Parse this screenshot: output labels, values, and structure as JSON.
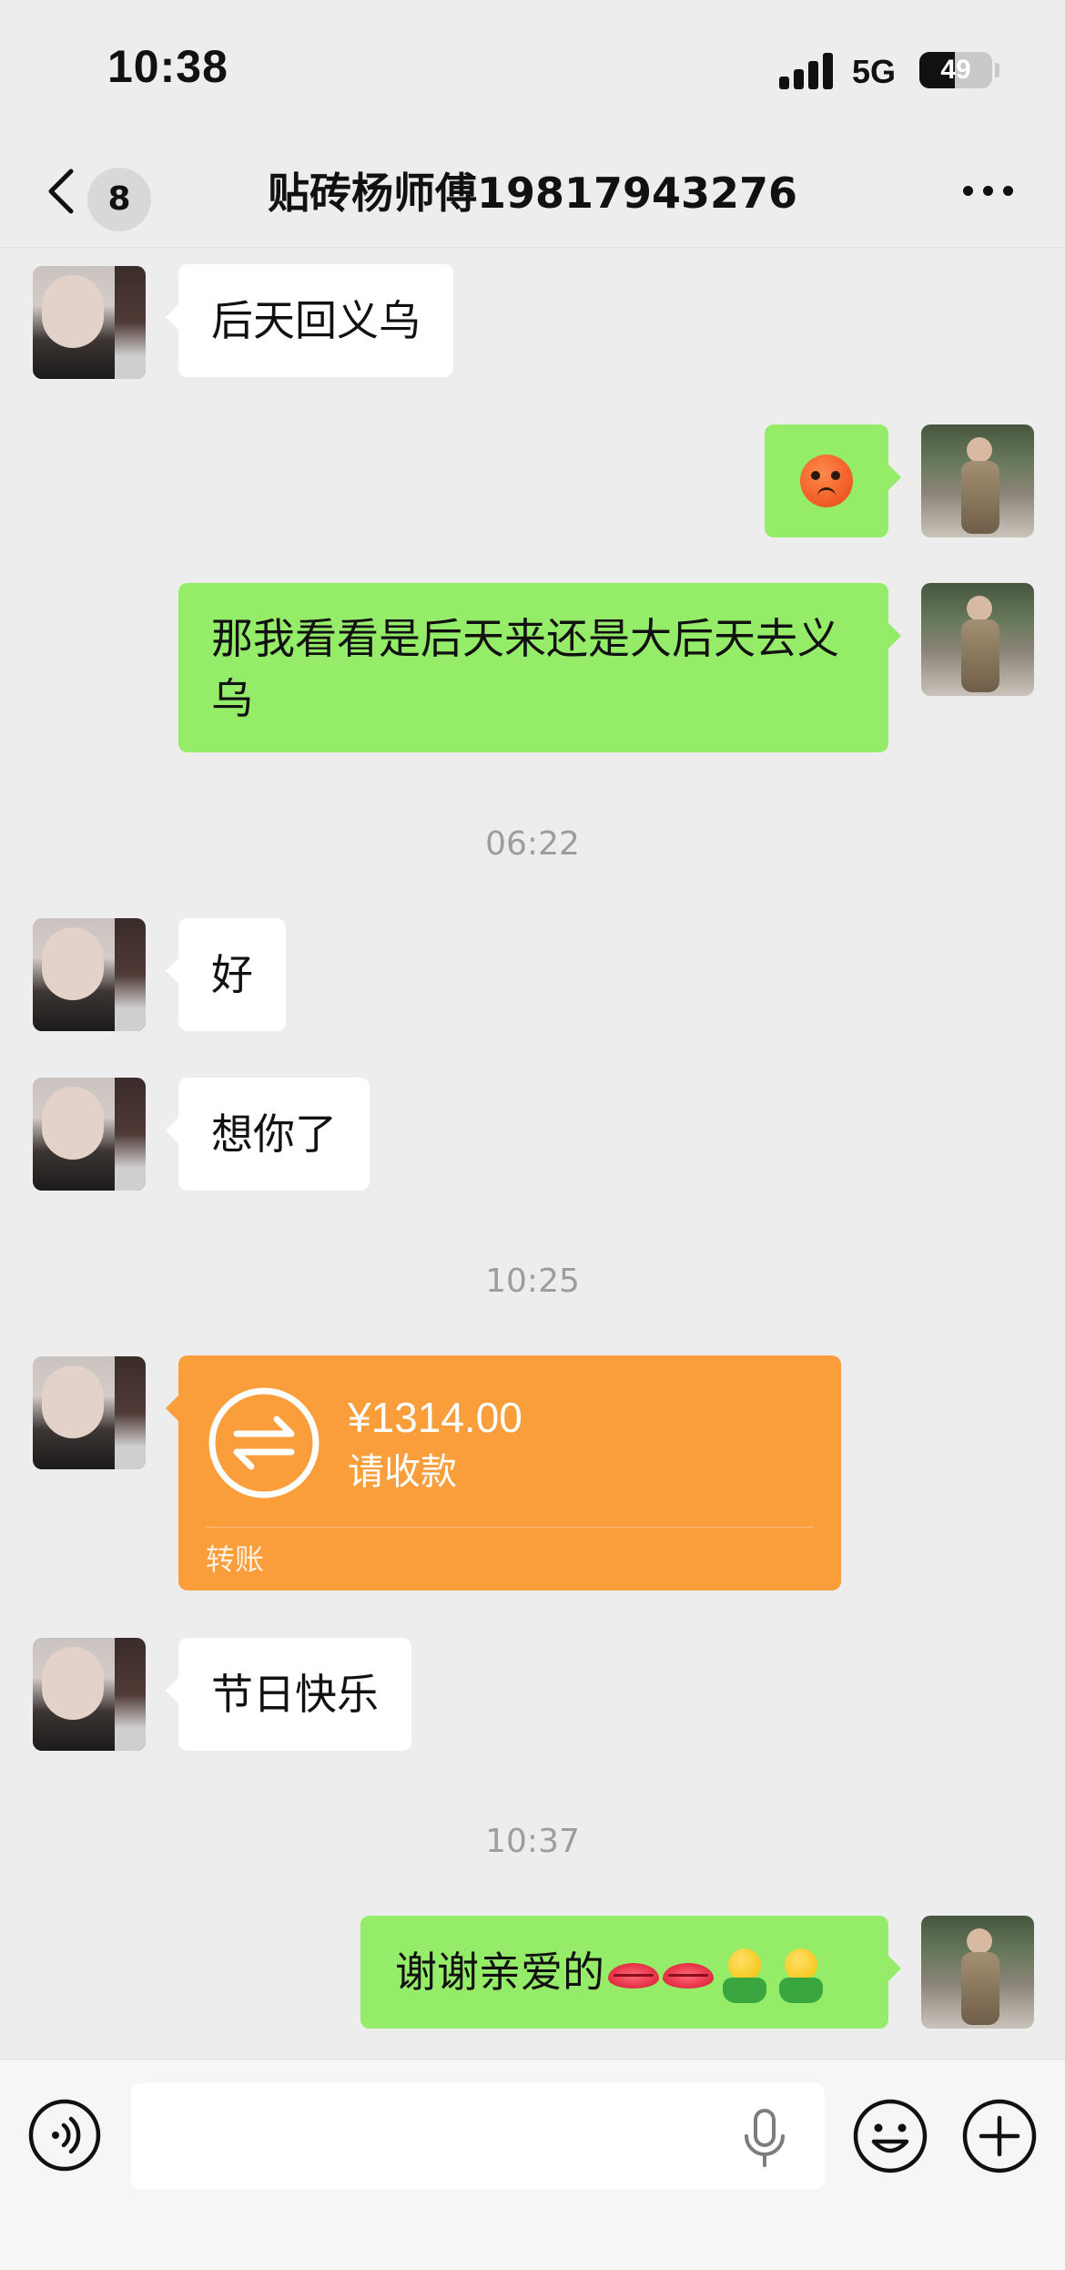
{
  "status_bar": {
    "time": "10:38",
    "network": "5G",
    "battery": "49",
    "battery_level_percent": 49,
    "signal_bars": 4
  },
  "nav": {
    "unread_count": "8",
    "title": "贴砖杨师傅19817943276",
    "icons": [
      "chevron-left-icon",
      "more-icon"
    ]
  },
  "messages": [
    {
      "from": "friend",
      "type": "text",
      "text": "后天回义乌"
    },
    {
      "from": "me",
      "type": "emoji",
      "emoji": "hot-face-emoji"
    },
    {
      "from": "me",
      "type": "text",
      "text": "那我看看是后天来还是大后天去义乌"
    },
    {
      "type": "timestamp",
      "text": "06:22"
    },
    {
      "from": "friend",
      "type": "text",
      "text": "好"
    },
    {
      "from": "friend",
      "type": "text",
      "text": "想你了"
    },
    {
      "type": "timestamp",
      "text": "10:25"
    },
    {
      "from": "friend",
      "type": "transfer",
      "amount": "¥1314.00",
      "status": "请收款",
      "label": "转账"
    },
    {
      "from": "friend",
      "type": "text",
      "text": "节日快乐"
    },
    {
      "type": "timestamp",
      "text": "10:37"
    },
    {
      "from": "me",
      "type": "text",
      "text": "谢谢亲爱的",
      "emojis": [
        "lips-emoji",
        "lips-emoji",
        "hug-emoji",
        "hug-emoji"
      ]
    }
  ],
  "input_bar": {
    "placeholder": "",
    "icons": [
      "voice-icon",
      "mic-icon",
      "emoji-icon",
      "plus-icon"
    ]
  },
  "colors": {
    "background": "#ededed",
    "outgoing_bubble": "#95ec69",
    "incoming_bubble": "#ffffff",
    "transfer_card": "#fa9d3b",
    "timestamp": "#9d9d9d"
  }
}
